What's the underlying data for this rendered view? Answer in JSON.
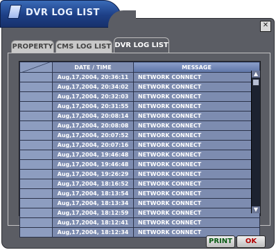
{
  "window": {
    "title": "DVR LOG LIST"
  },
  "tabs": [
    {
      "label": "PROPERTY"
    },
    {
      "label": "CMS LOG LIST"
    },
    {
      "label": "DVR LOG LIST"
    }
  ],
  "table": {
    "headers": [
      "",
      "DATE / TIME",
      "MESSAGE"
    ],
    "rows": [
      {
        "time": "Aug,17,2004, 20:36:11",
        "message": "NETWORK CONNECT"
      },
      {
        "time": "Aug,17,2004, 20:34:02",
        "message": "NETWORK CONNECT"
      },
      {
        "time": "Aug,17,2004, 20:32:03",
        "message": "NETWORK CONNECT"
      },
      {
        "time": "Aug,17,2004, 20:31:55",
        "message": "NETWORK CONNECT"
      },
      {
        "time": "Aug,17,2004, 20:08:14",
        "message": "NETWORK CONNECT"
      },
      {
        "time": "Aug,17,2004, 20:08:08",
        "message": "NETWORK CONNECT"
      },
      {
        "time": "Aug,17,2004, 20:07:52",
        "message": "NETWORK CONNECT"
      },
      {
        "time": "Aug,17,2004, 20:07:16",
        "message": "NETWORK CONNECT"
      },
      {
        "time": "Aug,17,2004, 19:46:48",
        "message": "NETWORK CONNECT"
      },
      {
        "time": "Aug,17,2004, 19:46:48",
        "message": "NETWORK CONNECT"
      },
      {
        "time": "Aug,17,2004, 19:26:29",
        "message": "NETWORK CONNECT"
      },
      {
        "time": "Aug,17,2004, 18:16:52",
        "message": "NETWORK CONNECT"
      },
      {
        "time": "Aug,17,2004, 18:13:54",
        "message": "NETWORK CONNECT"
      },
      {
        "time": "Aug,17,2004, 18:13:34",
        "message": "NETWORK CONNECT"
      },
      {
        "time": "Aug,17,2004, 18:12:59",
        "message": "NETWORK CONNECT"
      },
      {
        "time": "Aug,17,2004, 18:12:41",
        "message": "NETWORK CONNECT"
      },
      {
        "time": "Aug,17,2004, 18:12:34",
        "message": "NETWORK CONNECT"
      }
    ]
  },
  "buttons": {
    "print": "PRINT",
    "ok": "OK"
  },
  "icons": {
    "close": "close-icon",
    "scroll_up": "scroll-up-icon",
    "scroll_down": "scroll-down-icon",
    "title": "document-icon"
  },
  "colors": {
    "title_bar": "#1d3f86",
    "frame": "#5b5d64",
    "row": "#7d8cb0",
    "print": "#0a5a14",
    "ok": "#b00000"
  }
}
